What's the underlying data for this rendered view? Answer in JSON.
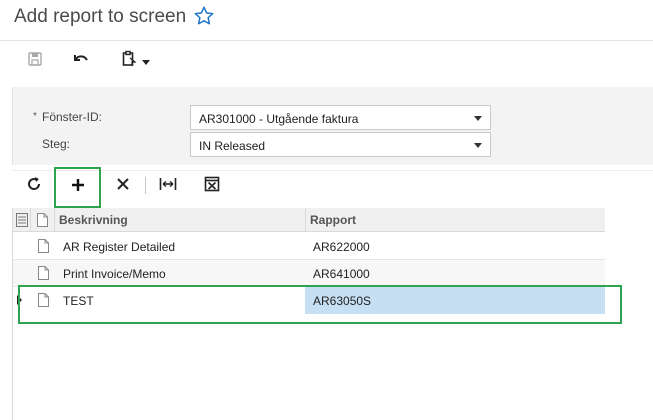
{
  "page": {
    "title": "Add report to screen",
    "favorite_icon": "star-icon"
  },
  "toolbar": {
    "save_icon": "save-icon",
    "undo_icon": "undo-icon",
    "clipboard_icon": "clipboard-icon"
  },
  "form": {
    "screen_id": {
      "label": "Fönster-ID:",
      "required_marker": "*",
      "value": "AR301000 - Utgående faktura"
    },
    "step": {
      "label": "Steg:",
      "value": "IN Released"
    }
  },
  "grid_toolbar": {
    "refresh_icon": "refresh-icon",
    "add_icon": "plus-icon",
    "delete_icon": "close-icon",
    "fit_icon": "fit-columns-icon",
    "excel_icon": "excel-export-icon"
  },
  "grid": {
    "columns": [
      "Beskrivning",
      "Rapport"
    ],
    "rows": [
      {
        "description": "AR Register Detailed",
        "report": "AR622000"
      },
      {
        "description": "Print Invoice/Memo",
        "report": "AR641000"
      },
      {
        "description": "TEST",
        "report": "AR63050S"
      }
    ],
    "selected_row": 2
  },
  "colors": {
    "highlight": "#2ea44f",
    "accent": "#1a73c8",
    "selected_cell": "#c7dff2"
  }
}
